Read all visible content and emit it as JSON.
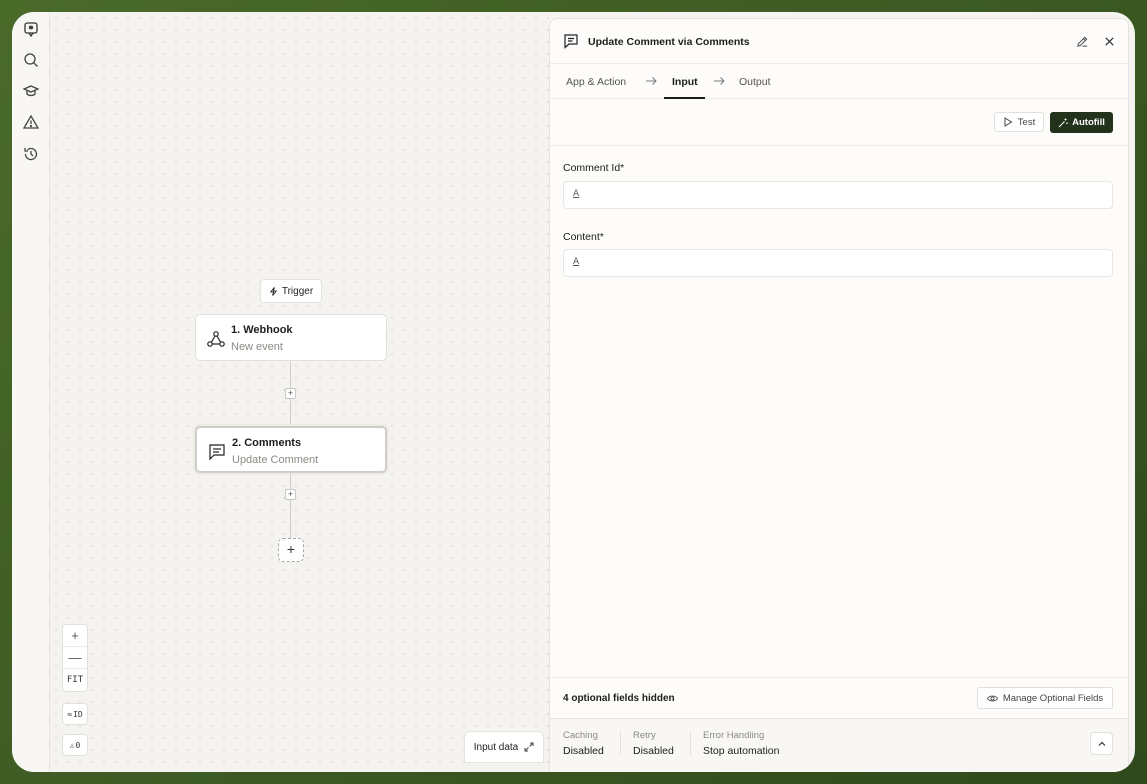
{
  "canvas": {
    "trigger_label": "Trigger",
    "nodes": [
      {
        "title": "1. Webhook",
        "subtitle": "New event"
      },
      {
        "title": "2. Comments",
        "subtitle": "Update Comment"
      }
    ],
    "plus_symbol": "+",
    "zoom": {
      "in": "+",
      "out": "—",
      "fit": "FIT"
    },
    "id_toggle": "ID",
    "warnings_count": "0",
    "input_data_label": "Input data"
  },
  "panel": {
    "title": "Update Comment via Comments",
    "tabs": [
      {
        "label": "App & Action"
      },
      {
        "label": "Input"
      },
      {
        "label": "Output"
      }
    ],
    "test_label": "Test",
    "autofill_label": "Autofill",
    "fields": [
      {
        "label": "Comment Id*",
        "value": "",
        "type_icon": "A"
      },
      {
        "label": "Content*",
        "value": "",
        "type_icon": "A"
      }
    ],
    "optional_hidden_text": "4 optional fields hidden",
    "manage_optional_label": "Manage Optional Fields",
    "settings": [
      {
        "label": "Caching",
        "value": "Disabled"
      },
      {
        "label": "Retry",
        "value": "Disabled"
      },
      {
        "label": "Error Handling",
        "value": "Stop automation"
      }
    ]
  },
  "colors": {
    "accent": "#23331b",
    "background_outer": "#3f5a26",
    "panel_bg": "#fdfcfa"
  }
}
